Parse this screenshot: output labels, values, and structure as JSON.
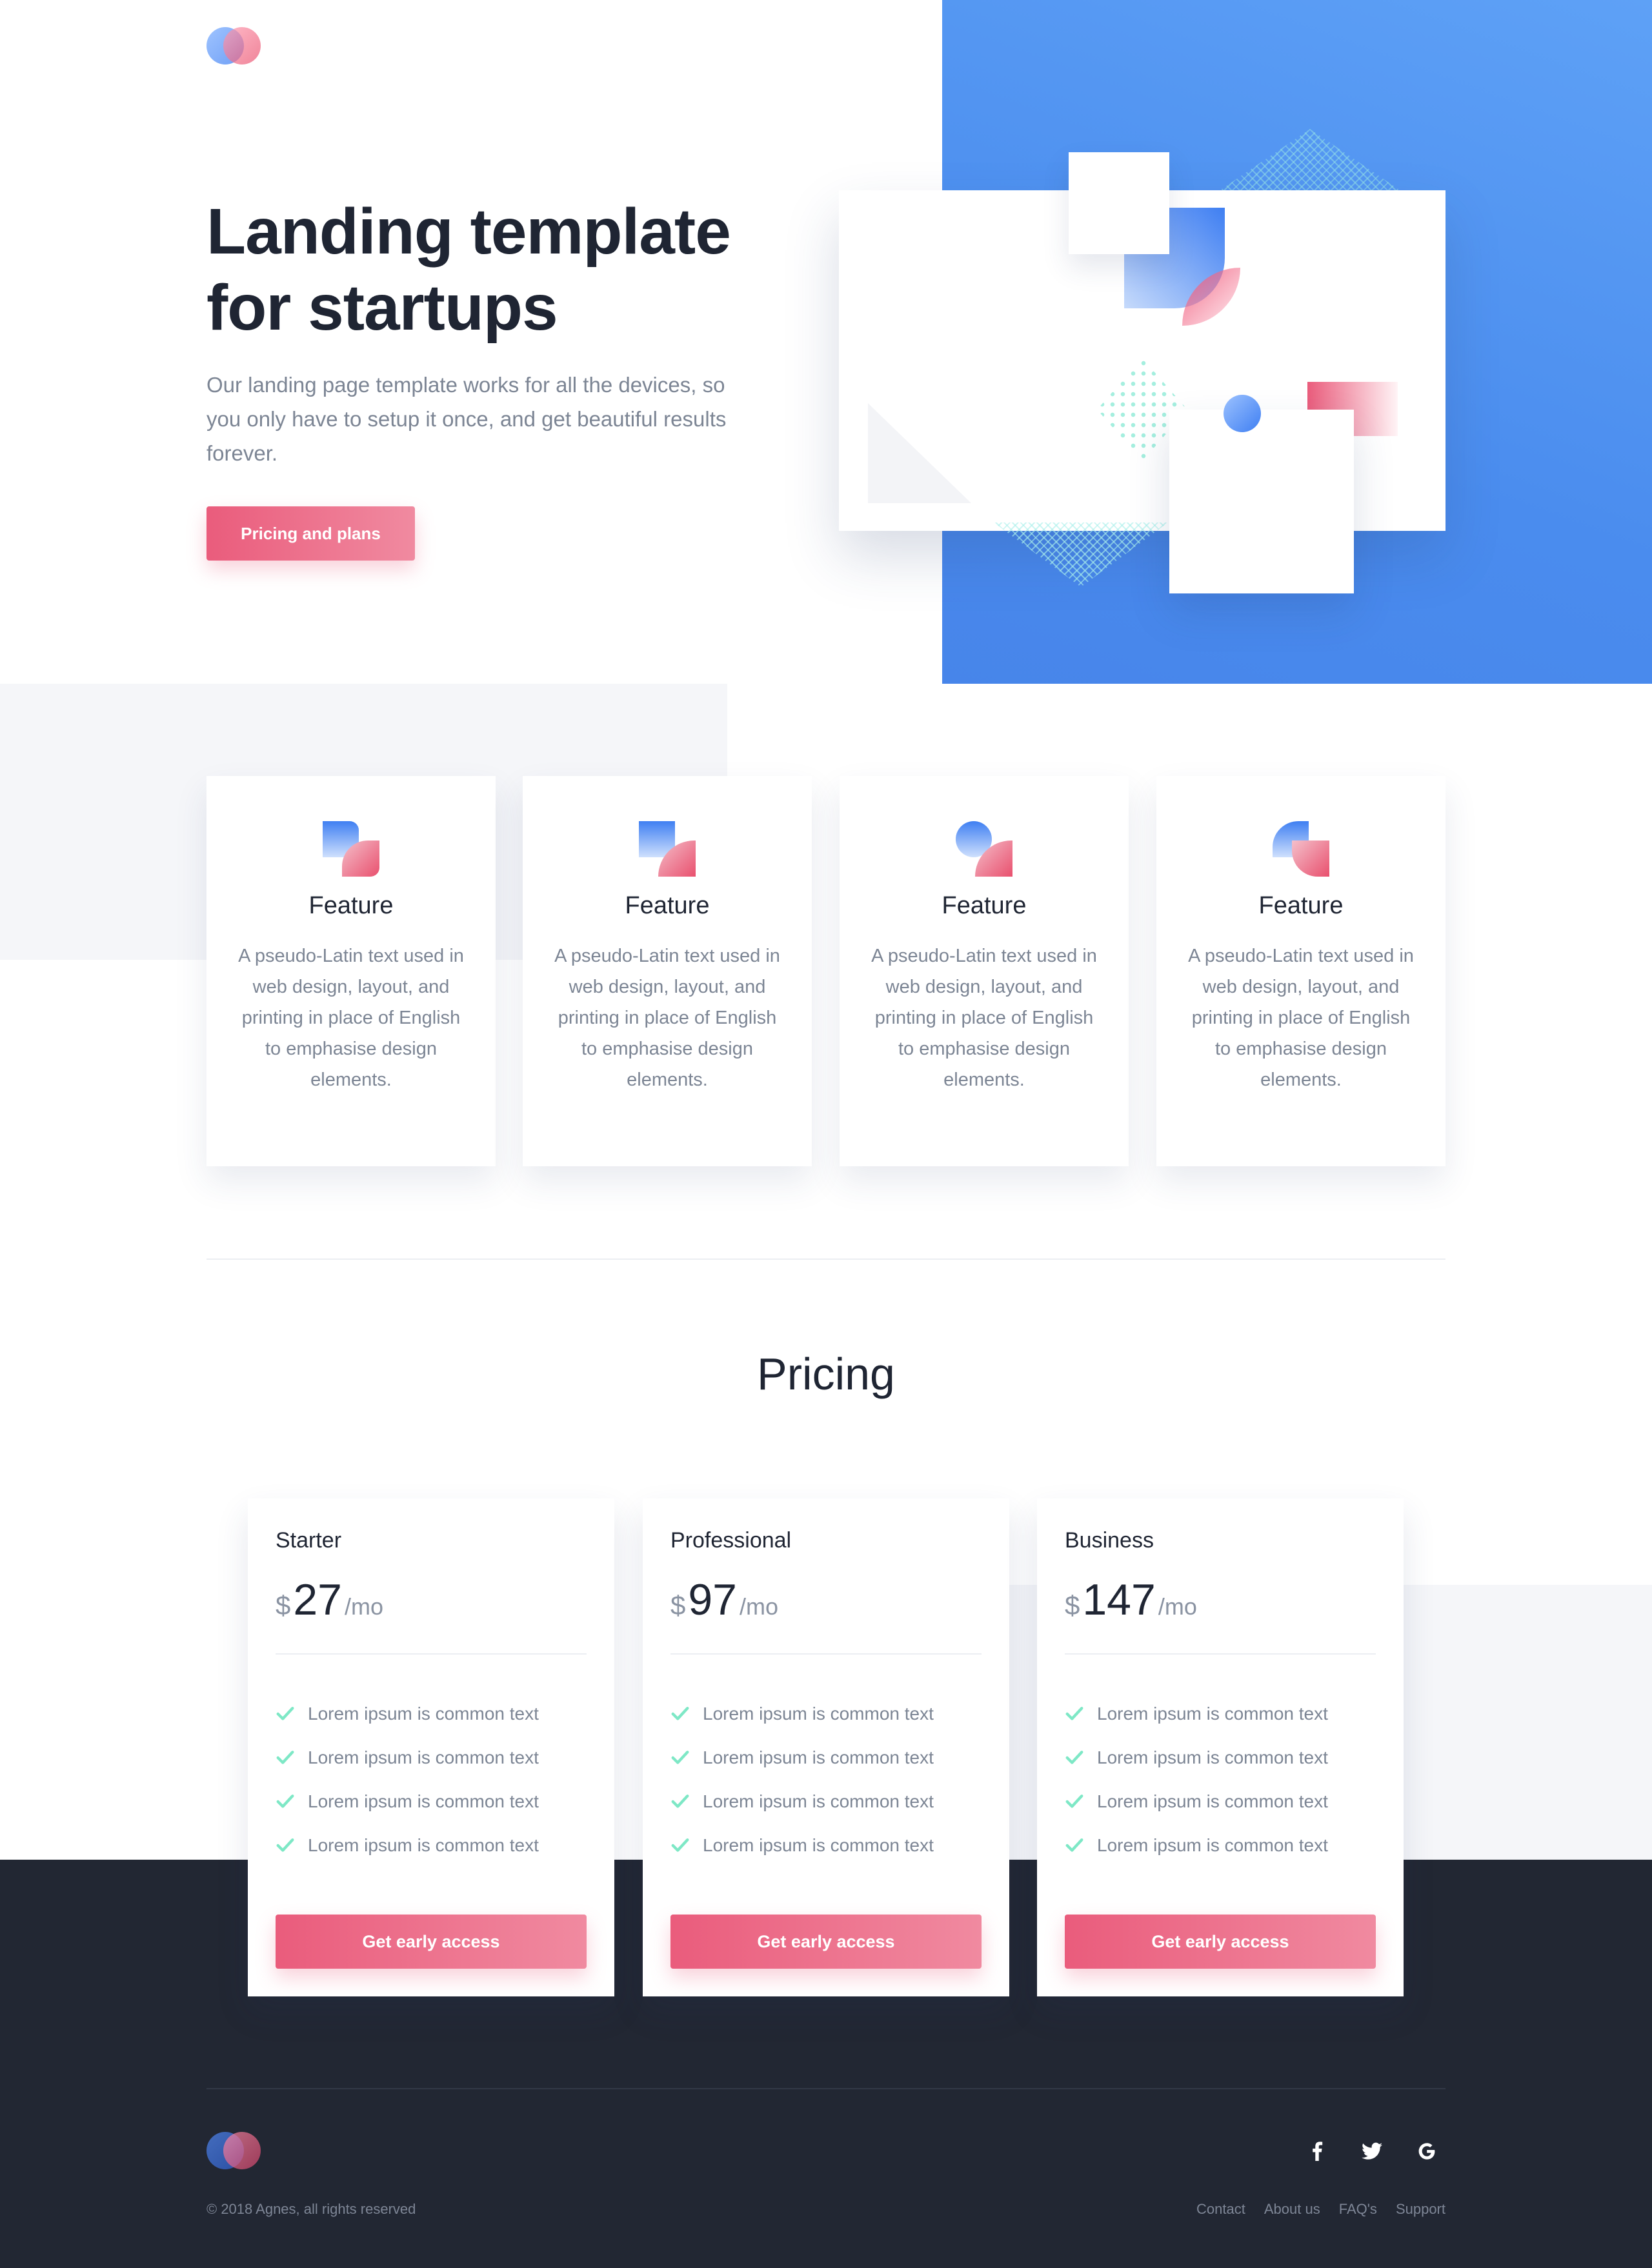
{
  "brand": {
    "logo": "logo-circles"
  },
  "hero": {
    "title": "Landing template for startups",
    "subtitle": "Our landing page template works for all the devices, so you only have to setup it once, and get beautiful results forever.",
    "cta_label": "Pricing and plans"
  },
  "features": [
    {
      "title": "Feature",
      "text": "A pseudo-Latin text used in web design, layout, and printing in place of English to emphasise design elements."
    },
    {
      "title": "Feature",
      "text": "A pseudo-Latin text used in web design, layout, and printing in place of English to emphasise design elements."
    },
    {
      "title": "Feature",
      "text": "A pseudo-Latin text used in web design, layout, and printing in place of English to emphasise design elements."
    },
    {
      "title": "Feature",
      "text": "A pseudo-Latin text used in web design, layout, and printing in place of English to emphasise design elements."
    }
  ],
  "pricing": {
    "title": "Pricing",
    "plans": [
      {
        "name": "Starter",
        "currency": "$",
        "amount": "27",
        "period": "/mo",
        "items": [
          "Lorem ipsum is common text",
          "Lorem ipsum is common text",
          "Lorem ipsum is common text",
          "Lorem ipsum is common text"
        ],
        "cta": "Get early access"
      },
      {
        "name": "Professional",
        "currency": "$",
        "amount": "97",
        "period": "/mo",
        "items": [
          "Lorem ipsum is common text",
          "Lorem ipsum is common text",
          "Lorem ipsum is common text",
          "Lorem ipsum is common text"
        ],
        "cta": "Get early access"
      },
      {
        "name": "Business",
        "currency": "$",
        "amount": "147",
        "period": "/mo",
        "items": [
          "Lorem ipsum is common text",
          "Lorem ipsum is common text",
          "Lorem ipsum is common text",
          "Lorem ipsum is common text"
        ],
        "cta": "Get early access"
      }
    ]
  },
  "footer": {
    "copyright": "© 2018 Agnes, all rights reserved",
    "social": [
      "facebook-icon",
      "twitter-icon",
      "google-icon"
    ],
    "links": [
      "Contact",
      "About us",
      "FAQ's",
      "Support"
    ]
  },
  "colors": {
    "accent_pink": "#EA5C7C",
    "accent_blue": "#4A8CEE",
    "check_green": "#7EE8C6",
    "footer_bg": "#222733",
    "text_dark": "#1F2533",
    "text_muted": "#7C8594"
  }
}
